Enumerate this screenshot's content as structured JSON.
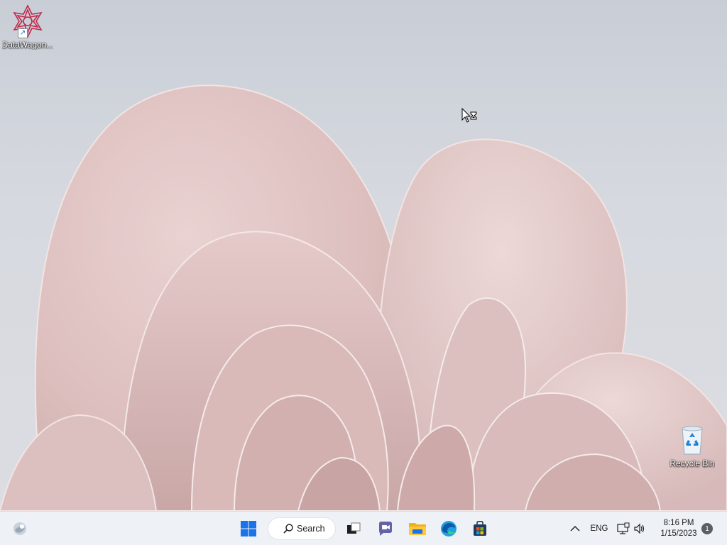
{
  "desktop": {
    "icons": [
      {
        "label": "DataWagon...",
        "icon": "datawagon-app-icon",
        "shortcut": true
      },
      {
        "label": "Recycle Bin",
        "icon": "recycle-bin-icon",
        "shortcut": false
      }
    ],
    "cursor": "busy-pointer-icon"
  },
  "taskbar": {
    "widgets_icon": "widgets-icon",
    "start_icon": "windows-start-icon",
    "search": {
      "label": "Search",
      "icon": "search-icon"
    },
    "pinned": [
      {
        "name": "Task View",
        "icon": "task-view-icon"
      },
      {
        "name": "Chat",
        "icon": "chat-icon"
      },
      {
        "name": "File Explorer",
        "icon": "file-explorer-icon"
      },
      {
        "name": "Microsoft Edge",
        "icon": "edge-icon"
      },
      {
        "name": "Microsoft Store",
        "icon": "store-icon"
      }
    ],
    "tray": {
      "overflow_icon": "chevron-up-icon",
      "language": "ENG",
      "network_icon": "network-icon",
      "volume_icon": "volume-icon",
      "time": "8:16 PM",
      "date": "1/15/2023",
      "notifications": "1"
    }
  },
  "colors": {
    "taskbar_bg": "#eef1f5",
    "wallpaper_petal": "#e6c8c6",
    "accent_blue": "#0a64d8"
  }
}
